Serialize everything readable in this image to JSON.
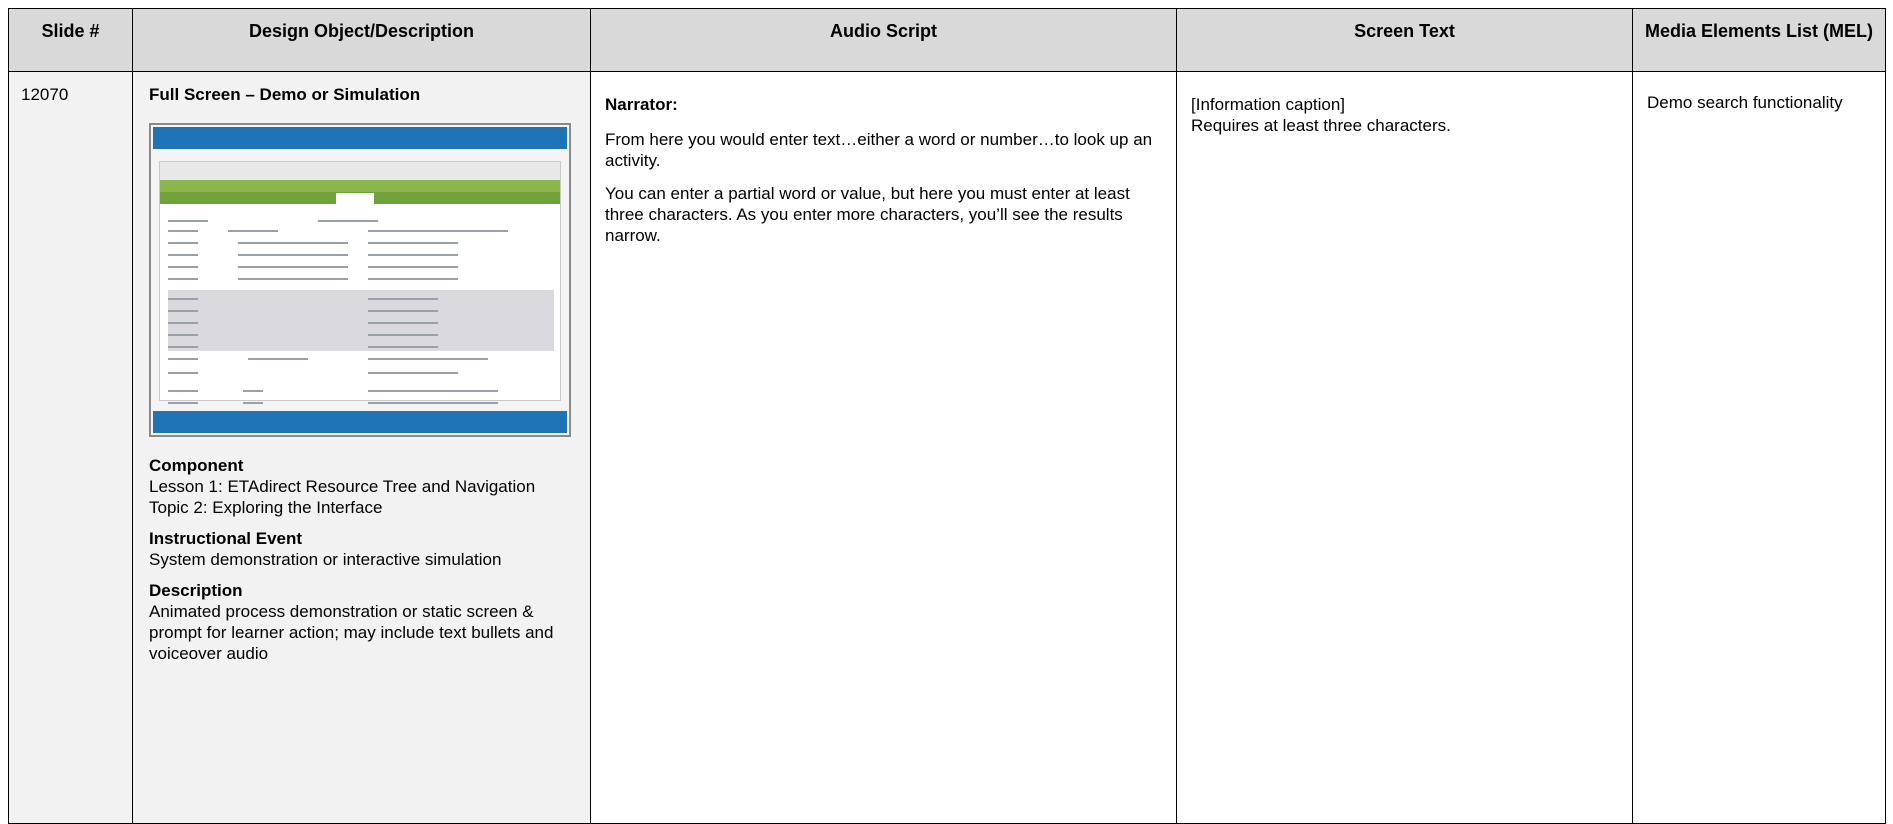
{
  "headers": {
    "slide": "Slide #",
    "design": "Design Object/Description",
    "audio": "Audio Script",
    "screen": "Screen Text",
    "mel": "Media Elements List (MEL)"
  },
  "row": {
    "slide_number": "12070",
    "design": {
      "title": "Full Screen – Demo or Simulation",
      "component_heading": "Component",
      "component_lines": [
        "Lesson 1: ETAdirect Resource Tree and Navigation",
        "Topic 2: Exploring the Interface"
      ],
      "event_heading": "Instructional Event",
      "event_text": "System demonstration or interactive simulation",
      "description_heading": "Description",
      "description_text": "Animated process demonstration or static screen & prompt for learner action; may include text bullets and voiceover audio"
    },
    "audio": {
      "speaker": "Narrator:",
      "paragraphs": [
        "From here you would enter text…either a word or number…to look up an activity.",
        "You can enter a partial word or value, but here you must enter at least three characters.  As you enter more characters, you’ll see the results narrow."
      ]
    },
    "screen_text": {
      "caption_label": "[Information caption]",
      "caption_text": "Requires at least three characters."
    },
    "mel": "Demo search functionality"
  },
  "colors": {
    "header_bg": "#d9d9d9",
    "shaded_cell_bg": "#f2f2f2",
    "thumb_bar": "#1f73b7",
    "thumb_green": "#8ab64a"
  }
}
